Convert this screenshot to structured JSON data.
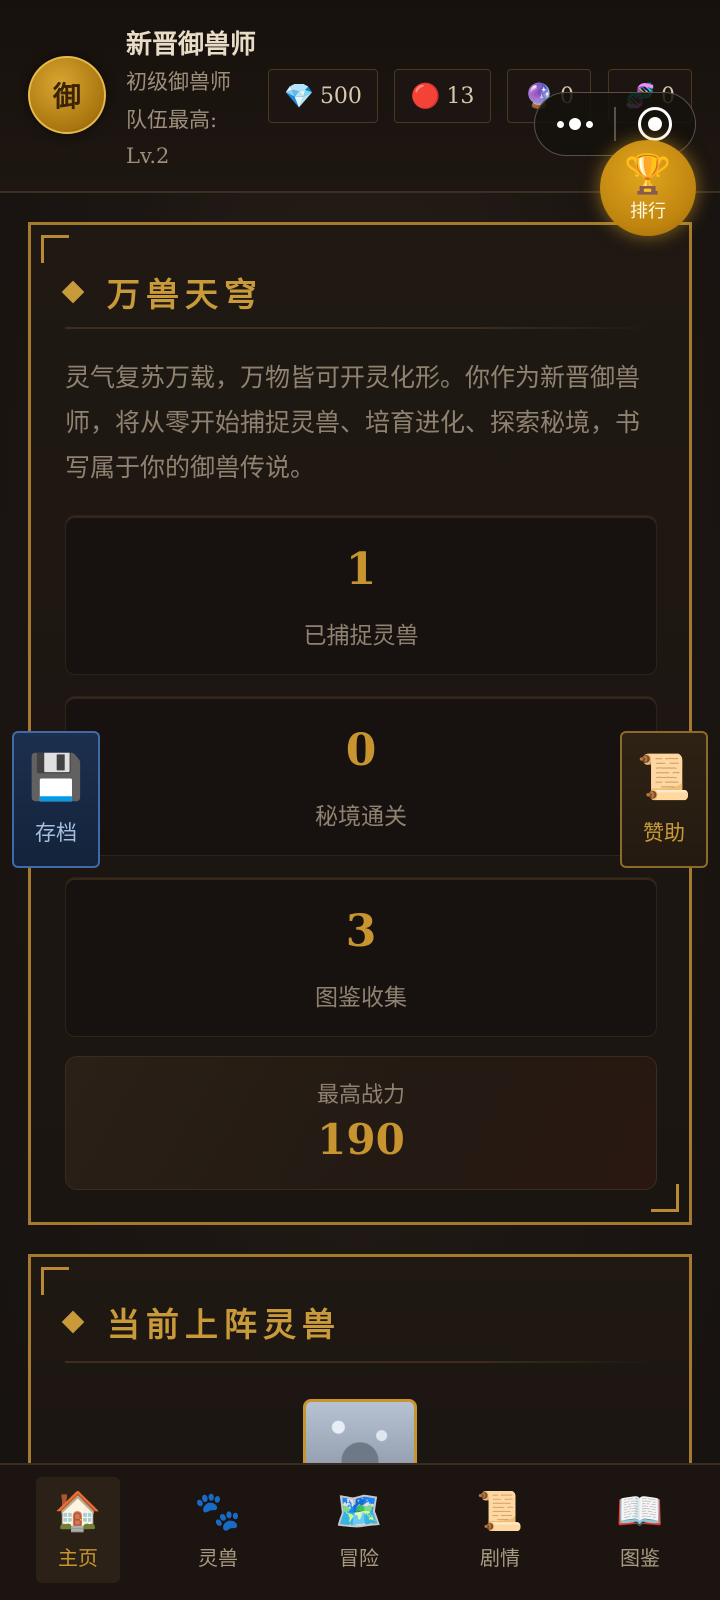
{
  "header": {
    "avatar_char": "御",
    "player_name": "新晋御兽师",
    "player_rank": "初级御兽师",
    "team_level": "队伍最高: Lv.2",
    "resources": [
      {
        "icon": "💎",
        "icon_name": "gem-icon",
        "value": "500"
      },
      {
        "icon": "🔴",
        "icon_name": "red-orb-icon",
        "value": "13"
      },
      {
        "icon": "🔮",
        "icon_name": "crystal-ball-icon",
        "value": "0"
      },
      {
        "icon": "🧬",
        "icon_name": "dna-icon",
        "value": "0"
      }
    ],
    "rank_button": {
      "icon": "🏆",
      "label": "排行"
    }
  },
  "intro_card": {
    "title": "万兽天穹",
    "description": "灵气复苏万载，万物皆可开灵化形。你作为新晋御兽师，将从零开始捕捉灵兽、培育进化、探索秘境，书写属于你的御兽传说。",
    "stats": [
      {
        "value": "1",
        "label": "已捕捉灵兽"
      },
      {
        "value": "0",
        "label": "秘境通关"
      },
      {
        "value": "3",
        "label": "图鉴收集"
      }
    ],
    "power": {
      "label": "最高战力",
      "value": "190"
    }
  },
  "team_card": {
    "title": "当前上阵灵兽"
  },
  "side_buttons": {
    "save": {
      "icon": "💾",
      "label": "存档"
    },
    "sponsor": {
      "icon": "📜",
      "label": "赞助"
    }
  },
  "tabbar": {
    "items": [
      {
        "icon": "🏠",
        "label": "主页"
      },
      {
        "icon": "🐾",
        "label": "灵兽"
      },
      {
        "icon": "🗺️",
        "label": "冒险"
      },
      {
        "icon": "📜",
        "label": "剧情"
      },
      {
        "icon": "📖",
        "label": "图鉴"
      }
    ]
  },
  "colors": {
    "gold_accent": "#c7942f",
    "card_border": "#a57a2c",
    "background": "#1a1410"
  }
}
